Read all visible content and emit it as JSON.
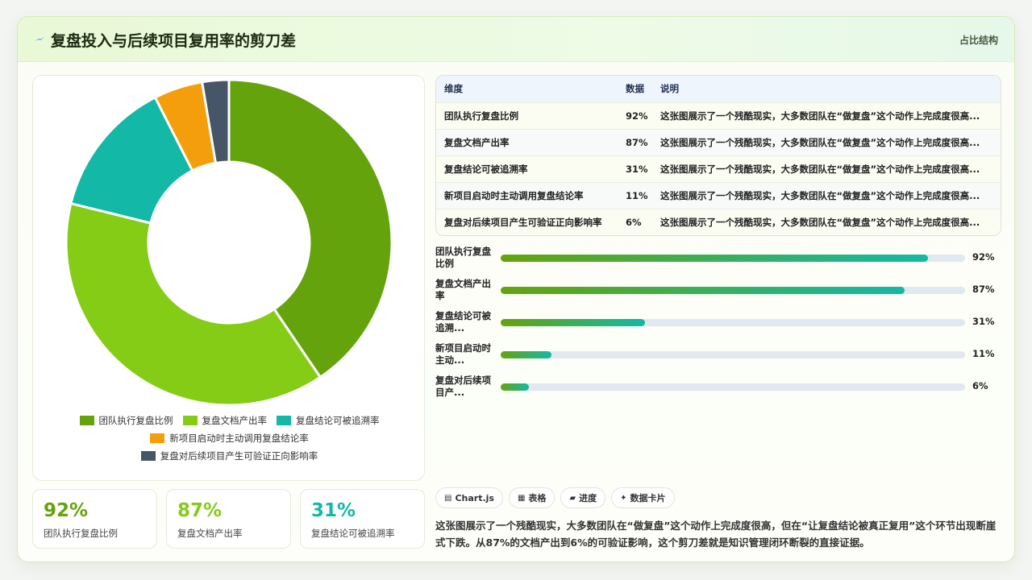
{
  "header": {
    "title": "复盘投入与后续项目复用率的剪刀差",
    "tag": "占比结构"
  },
  "colors": {
    "series": [
      "#65a30d",
      "#84cc16",
      "#14b8a6",
      "#f59e0b",
      "#475569"
    ],
    "accent": "#65a30d",
    "teal": "#14b8a6"
  },
  "chart_data": {
    "type": "pie",
    "donut": true,
    "categories": [
      "团队执行复盘比例",
      "复盘文档产出率",
      "复盘结论可被追溯率",
      "新项目启动时主动调用复盘结论率",
      "复盘对后续项目产生可验证正向影响率"
    ],
    "values": [
      92,
      87,
      31,
      11,
      6
    ],
    "legend_position": "bottom"
  },
  "stat_cards": [
    {
      "value": "92%",
      "label": "团队执行复盘比例"
    },
    {
      "value": "87%",
      "label": "复盘文档产出率"
    },
    {
      "value": "31%",
      "label": "复盘结论可被追溯率"
    }
  ],
  "table": {
    "headers": [
      "维度",
      "数据",
      "说明"
    ],
    "rows": [
      [
        "团队执行复盘比例",
        "92%",
        "这张图展示了一个残酷现实，大多数团队在“做复盘”这个动作上完成度很高..."
      ],
      [
        "复盘文档产出率",
        "87%",
        "这张图展示了一个残酷现实，大多数团队在“做复盘”这个动作上完成度很高..."
      ],
      [
        "复盘结论可被追溯率",
        "31%",
        "这张图展示了一个残酷现实，大多数团队在“做复盘”这个动作上完成度很高..."
      ],
      [
        "新项目启动时主动调用复盘结论率",
        "11%",
        "这张图展示了一个残酷现实，大多数团队在“做复盘”这个动作上完成度很高..."
      ],
      [
        "复盘对后续项目产生可验证正向影响率",
        "6%",
        "这张图展示了一个残酷现实，大多数团队在“做复盘”这个动作上完成度很高..."
      ]
    ]
  },
  "progress": [
    {
      "label": "团队执行复盘比例",
      "value": 92,
      "display": "92%"
    },
    {
      "label": "复盘文档产出率",
      "value": 87,
      "display": "87%"
    },
    {
      "label": "复盘结论可被追溯...",
      "value": 31,
      "display": "31%"
    },
    {
      "label": "新项目启动时主动...",
      "value": 11,
      "display": "11%"
    },
    {
      "label": "复盘对后续项目产...",
      "value": 6,
      "display": "6%"
    }
  ],
  "chips": [
    {
      "icon": "chart-icon",
      "label": "Chart.js"
    },
    {
      "icon": "table-icon",
      "label": "表格"
    },
    {
      "icon": "progress-icon",
      "label": "进度"
    },
    {
      "icon": "sparkle-icon",
      "label": "数据卡片"
    }
  ],
  "description": "这张图展示了一个残酷现实，大多数团队在“做复盘”这个动作上完成度很高，但在“让复盘结论被真正复用”这个环节出现断崖式下跌。从87%的文档产出到6%的可验证影响，这个剪刀差就是知识管理闭环断裂的直接证据。"
}
